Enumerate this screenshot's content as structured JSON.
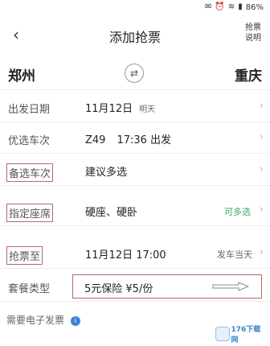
{
  "status_bar": {
    "battery": "86%"
  },
  "header": {
    "title": "添加抢票",
    "back_icon": "back-arrow-icon",
    "help_label_line1": "抢票",
    "help_label_line2": "说明"
  },
  "route": {
    "from": "郑州",
    "to": "重庆",
    "swap_icon": "swap-arrows-icon"
  },
  "rows": {
    "date": {
      "label": "出发日期",
      "value": "11月12日",
      "sub": "明天"
    },
    "train": {
      "label": "优选车次",
      "code": "Z49",
      "time": "17:36 出发"
    },
    "backup": {
      "label": "备选车次",
      "placeholder": "建议多选"
    },
    "seat": {
      "label": "指定座席",
      "value": "硬座、硬卧",
      "tag": "可多选"
    },
    "until": {
      "label": "抢票至",
      "value": "11月12日 17:00",
      "note": "发车当天"
    },
    "package": {
      "label": "套餐类型",
      "value": "5元保险 ¥5/份"
    }
  },
  "invoice": {
    "label": "需要电子发票",
    "icon": "info-icon"
  },
  "watermark": {
    "text": "176下载网"
  },
  "colors": {
    "annotation": "#b86a6a",
    "accent_green": "#3aa86b",
    "info_blue": "#3a84d0"
  }
}
